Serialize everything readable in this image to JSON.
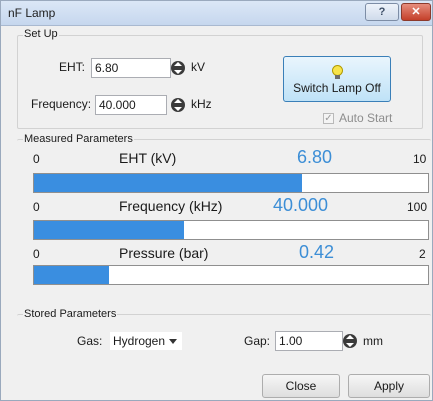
{
  "window": {
    "title": "nF Lamp",
    "help_glyph": "?",
    "close_glyph": "✕"
  },
  "setup": {
    "group_label": "Set Up",
    "eht": {
      "label": "EHT:",
      "value": "6.80",
      "unit": "kV"
    },
    "frequency": {
      "label": "Frequency:",
      "value": "40.000",
      "unit": "kHz"
    },
    "switch_button_label": "Switch Lamp Off",
    "auto_start": {
      "label": "Auto Start",
      "checked": true,
      "enabled": false
    }
  },
  "measured": {
    "group_label": "Measured Parameters",
    "items": [
      {
        "min": "0",
        "name": "EHT  (kV)",
        "value": "6.80",
        "max": "10",
        "fill_fraction": 0.68
      },
      {
        "min": "0",
        "name": "Frequency (kHz)",
        "value": "40.000",
        "max": "100",
        "fill_fraction": 0.38
      },
      {
        "min": "0",
        "name": "Pressure (bar)",
        "value": "0.42",
        "max": "2",
        "fill_fraction": 0.19
      }
    ]
  },
  "stored": {
    "group_label": "Stored Parameters",
    "gas": {
      "label": "Gas:",
      "value": "Hydrogen"
    },
    "gap": {
      "label": "Gap:",
      "value": "1.00",
      "unit": "mm"
    }
  },
  "buttons": {
    "close": "Close",
    "apply": "Apply"
  },
  "colors": {
    "value_text": "#3c8ed6",
    "bar_fill": "#3a8ee0",
    "bulb": "#f7e44a",
    "close_button": "#c4402a"
  }
}
